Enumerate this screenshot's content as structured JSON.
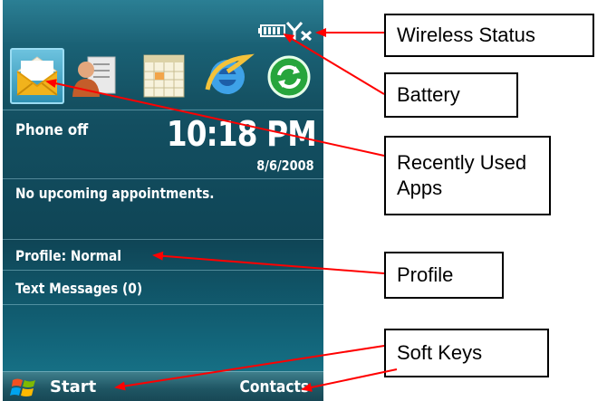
{
  "home_screen": {
    "phone_status": "Phone off",
    "clock_time": "10:18 PM",
    "clock_date": "8/6/2008",
    "appointments": "No upcoming appointments.",
    "profile": "Profile: Normal",
    "text_messages": "Text Messages (0)"
  },
  "recent_apps": [
    "messaging-icon",
    "contacts-icon",
    "calendar-icon",
    "internet-explorer-icon",
    "sync-icon"
  ],
  "status_icons": [
    "battery-icon",
    "wireless-off-icon"
  ],
  "soft_keys": {
    "left": "Start",
    "right": "Contacts"
  },
  "callouts": {
    "wireless_status": "Wireless Status",
    "battery": "Battery",
    "recently_used_apps": "Recently Used Apps",
    "profile": "Profile",
    "soft_keys": "Soft Keys"
  },
  "colors": {
    "screen_teal": "#134f61",
    "arrow_red": "#ff0000",
    "text_white": "#ffffff"
  }
}
